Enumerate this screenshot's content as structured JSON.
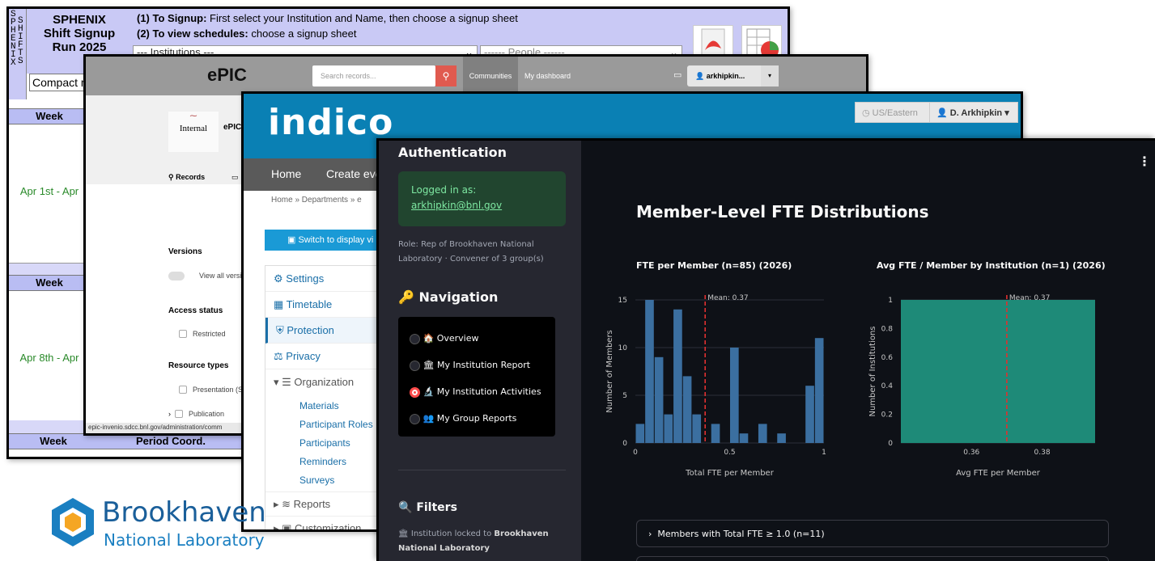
{
  "sphenix": {
    "vertical_letters": [
      "S",
      "P",
      "H",
      "E",
      "N",
      "I",
      "X"
    ],
    "vertical_letters2": [
      "S",
      "H",
      "I",
      "F",
      "T",
      "S"
    ],
    "title_lines": [
      "SPHENIX",
      "Shift Signup",
      "Run 2025"
    ],
    "instr1_bold": "(1) To Signup:",
    "instr1_rest": " First select your Institution and Name, then choose a signup sheet",
    "instr2_bold": "(2) To view schedules:",
    "instr2_rest": " choose a signup sheet",
    "institutions_select": "--- Institutions ---",
    "people_select": "------ People ------",
    "compact_select": "Compact m",
    "week_label": "Week",
    "row1_date": "Apr 1st - Apr",
    "row2_date": "Apr 8th - Apr",
    "period_coord": "Period Coord."
  },
  "epic": {
    "logo": "ePIC",
    "search_placeholder": "Search records...",
    "nav_communities": "Communities",
    "nav_dashboard": "My dashboard",
    "user": "arkhipkin...",
    "community_name": "ePIC",
    "internal_label": "Internal",
    "tab_records": "Records",
    "versions_heading": "Versions",
    "view_all_versions": "View all versi",
    "access_status": "Access status",
    "restricted": "Restricted",
    "resource_types": "Resource types",
    "presentation": "Presentation (S",
    "publication": "Publication",
    "status_url": "epic-invenio.sdcc.bnl.gov/administration/comm"
  },
  "indico": {
    "logo": "indico",
    "timezone": "US/Eastern",
    "user": "D. Arkhipkin",
    "nav_home": "Home",
    "nav_create": "Create eve",
    "breadcrumb": "Home  »  Departments  »  e",
    "switch_display": "Switch to display vi",
    "menu": [
      "Settings",
      "Timetable",
      "Protection",
      "Privacy",
      "Organization"
    ],
    "submenu": [
      "Materials",
      "Participant Roles",
      "Participants",
      "Reminders",
      "Surveys"
    ],
    "reports": "Reports",
    "customization": "Customization"
  },
  "dashboard": {
    "auth_heading": "Authentication",
    "logged_in_as": "Logged in as:",
    "email": "arkhipkin@bnl.gov",
    "role_text": "Role: Rep of Brookhaven National Laboratory · Convener of 3 group(s)",
    "navigation_heading": "Navigation",
    "nav_items": [
      {
        "icon": "🏠",
        "label": "Overview",
        "selected": false
      },
      {
        "icon": "🏛",
        "label": "My Institution Report",
        "selected": false
      },
      {
        "icon": "🔬",
        "label": "My Institution Activities",
        "selected": true
      },
      {
        "icon": "👥",
        "label": "My Group Reports",
        "selected": false
      }
    ],
    "filters_heading": "Filters",
    "filter_locked_prefix": "Institution locked to ",
    "filter_locked_inst": "Brookhaven National Laboratory",
    "menu_dots": "⋮",
    "page_title": "Member-Level FTE Distributions",
    "expander_label": "Members with Total FTE ≥ 1.0 (n=11)"
  },
  "bnl_logo": {
    "line1": "Brookhaven",
    "line2": "National Laboratory"
  },
  "colors": {
    "accent_red": "#ff4b4b",
    "bar_blue": "#3b6fa0",
    "bar_teal": "#1e8a78",
    "indico_blue": "#0a80b4",
    "sphenix_lavender": "#c9c9f5"
  },
  "chart_data": [
    {
      "type": "bar",
      "title": "FTE per Member  (n=85) (2026)",
      "xlabel": "Total FTE per Member",
      "ylabel": "Number of Members",
      "xlim": [
        0,
        1
      ],
      "ylim": [
        0,
        15
      ],
      "xticks": [
        0,
        0.5,
        1
      ],
      "yticks": [
        0,
        5,
        10,
        15
      ],
      "bin_width": 0.05,
      "bins_left": [
        0.0,
        0.05,
        0.1,
        0.15,
        0.2,
        0.25,
        0.3,
        0.35,
        0.4,
        0.45,
        0.5,
        0.55,
        0.6,
        0.65,
        0.7,
        0.75,
        0.8,
        0.85,
        0.9,
        0.95
      ],
      "values": [
        2,
        15,
        9,
        3,
        14,
        7,
        3,
        0,
        2,
        0,
        10,
        1,
        0,
        2,
        0,
        1,
        0,
        0,
        6,
        11
      ],
      "mean": 0.37,
      "mean_label": "Mean: 0.37"
    },
    {
      "type": "bar",
      "title": "Avg FTE / Member by Institution  (n=1) (2026)",
      "xlabel": "Avg FTE per Member",
      "ylabel": "Number of Institutions",
      "xlim": [
        0.34,
        0.395
      ],
      "ylim": [
        0,
        1
      ],
      "xticks": [
        0.36,
        0.38
      ],
      "yticks": [
        0,
        0.2,
        0.4,
        0.6,
        0.8,
        1
      ],
      "bins": [
        {
          "x0": 0.34,
          "x1": 0.395,
          "value": 1
        }
      ],
      "mean": 0.37,
      "mean_label": "Mean: 0.37"
    }
  ]
}
